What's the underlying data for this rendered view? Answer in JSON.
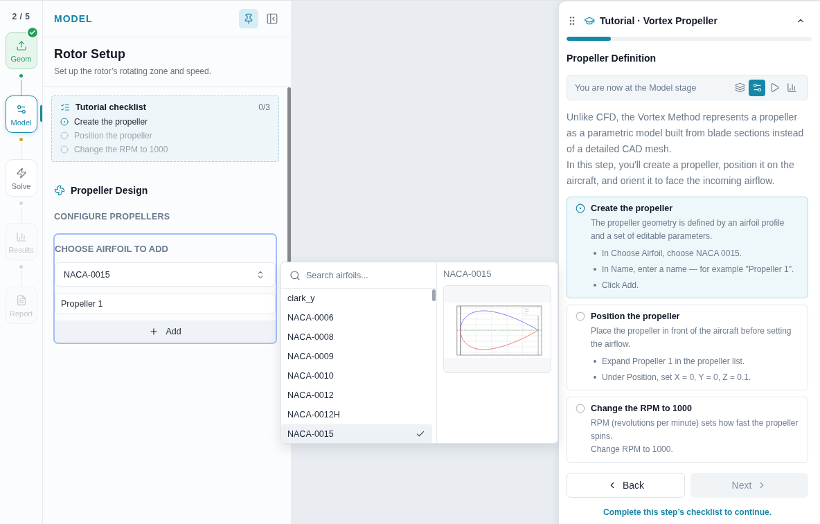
{
  "step_rail": {
    "counter": "2 / 5",
    "steps": [
      {
        "kind": "geometry",
        "label": "Geom",
        "completed": true,
        "selected": false,
        "disabled": false
      },
      {
        "kind": "model",
        "label": "Model",
        "completed": false,
        "selected": true,
        "disabled": false
      },
      {
        "kind": "solve",
        "label": "Solve",
        "completed": false,
        "selected": false,
        "disabled": false
      },
      {
        "kind": "results",
        "label": "Results",
        "completed": false,
        "selected": false,
        "disabled": true
      },
      {
        "kind": "report",
        "label": "Report",
        "completed": false,
        "selected": false,
        "disabled": true
      }
    ]
  },
  "model_panel": {
    "header": "MODEL",
    "pinned": true,
    "title": "Rotor Setup",
    "subtitle": "Set up the rotor’s rotating zone and speed.",
    "checklist": {
      "title": "Tutorial checklist",
      "count": "0/3",
      "items": [
        {
          "label": "Create the propeller",
          "active": true
        },
        {
          "label": "Position the propeller",
          "active": false
        },
        {
          "label": "Change the RPM to 1000",
          "active": false
        }
      ]
    },
    "section_title": "Propeller Design",
    "group_label": "CONFIGURE PROPELLERS",
    "add_form": {
      "label": "CHOOSE AIRFOIL TO ADD",
      "airfoil": "NACA-0015",
      "name": "Propeller 1",
      "add_button": "Add"
    }
  },
  "airfoil_dropdown": {
    "placeholder": "Search airfoils...",
    "options": [
      {
        "label": "clark_y",
        "selected": false
      },
      {
        "label": "NACA-0006",
        "selected": false
      },
      {
        "label": "NACA-0008",
        "selected": false
      },
      {
        "label": "NACA-0009",
        "selected": false
      },
      {
        "label": "NACA-0010",
        "selected": false
      },
      {
        "label": "NACA-0012",
        "selected": false
      },
      {
        "label": "NACA-0012H",
        "selected": false
      },
      {
        "label": "NACA-0015",
        "selected": true
      }
    ],
    "preview_title": "NACA-0015"
  },
  "tutorial": {
    "title": "Tutorial · Vortex Propeller",
    "expanded": true,
    "progress": {
      "level": 0.18
    },
    "step_title": "Propeller Definition",
    "stage_bar": {
      "text": "You are now at the Model stage",
      "stages": [
        {
          "kind": "geometry",
          "selected": false
        },
        {
          "kind": "model",
          "selected": true
        },
        {
          "kind": "solve",
          "selected": false
        },
        {
          "kind": "results",
          "selected": false
        }
      ]
    },
    "intro": [
      "Unlike CFD, the Vortex Method represents a propeller as a parametric model built from blade sections instead of a detailed CAD mesh.",
      "In this step, you'll create a propeller, position it on the aircraft, and orient it to face the incoming airflow."
    ],
    "steps": [
      {
        "title": "Create the propeller",
        "active": true,
        "paragraphs": [
          "The propeller geometry is defined by an airfoil profile and a set of editable parameters."
        ],
        "bullets": [
          "In Choose Airfoil, choose NACA 0015.",
          "In Name, enter a name — for example \"Propeller 1\".",
          "Click Add."
        ]
      },
      {
        "title": "Position the propeller",
        "active": false,
        "paragraphs": [
          "Place the propeller in front of the aircraft before setting the airflow."
        ],
        "bullets": [
          "Expand Propeller 1 in the propeller list.",
          "Under Position, set X = 0, Y = 0, Z = 0.1."
        ]
      },
      {
        "title": "Change the RPM to 1000",
        "active": false,
        "paragraphs": [
          "RPM (revolutions per minute) sets how fast the propeller spins.",
          "Change RPM to 1000."
        ]
      }
    ],
    "back_button": {
      "label": "Back"
    },
    "next_button": {
      "label": "Next",
      "disabled": true
    },
    "footer_note": "Complete this step’s checklist to continue."
  }
}
